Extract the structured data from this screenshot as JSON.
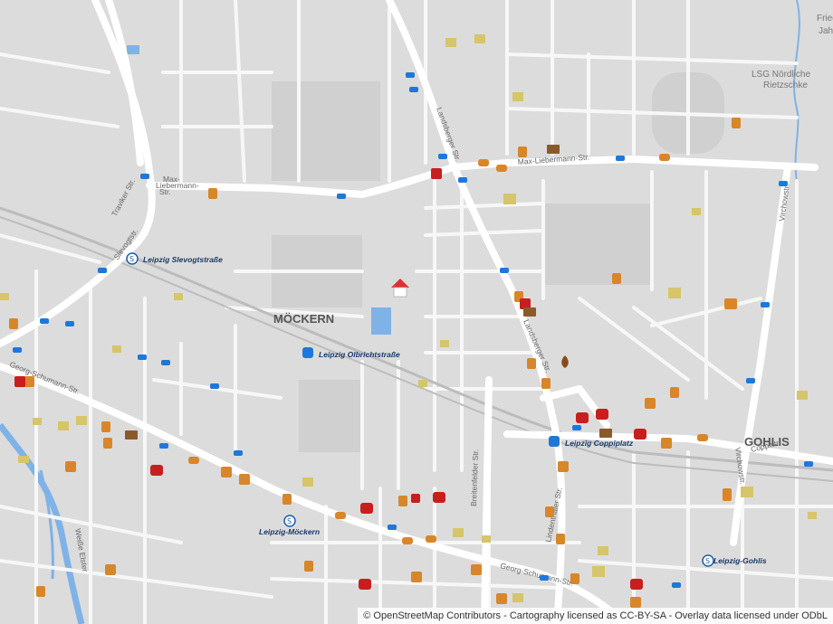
{
  "map": {
    "districts": {
      "moeckern": "MÖCKERN",
      "gohlis": "GOHLIS"
    },
    "areas": {
      "lsg_line1": "LSG Nördliche",
      "lsg_line2": "Rietzschke",
      "corner_line1": "Fried",
      "corner_line2": "Jahn"
    },
    "streets": {
      "traviker": "Traviker Str.",
      "slevogt": "Slevogtstr.",
      "max_liebermann_short1": "Max-",
      "max_liebermann_short2": "Liebermann-",
      "max_liebermann_short3": "Str.",
      "max_liebermann": "Max-Liebermann-Str.",
      "landsberger_top": "Landsberger Str.",
      "landsberger": "Landsberger Str.",
      "virchow_top": "Virchowstr.",
      "virchow_bottom": "Virchowstr.",
      "georg_schumann": "Georg-Schumann-Str.",
      "georg_schumann_b": "Georg-Schumann-Str.",
      "breitenfelder": "Breitenfelder Str.",
      "lindenthaler": "Lindenthaler Str.",
      "coppistr": "Coppistr.",
      "weisse_elster": "Weiße Elster"
    },
    "stops": {
      "slevogtstrasse": "Leipzig Slevogtstraße",
      "olbrichtstrasse": "Leipzig Olbrichtstraße",
      "coppiplatz": "Leipzig Coppiplatz",
      "moeckern_station": "Leipzig-Möckern",
      "gohlis_station": "Leipzig-Gohlis"
    },
    "attribution": "© OpenStreetMap Contributors - Cartography licensed as CC-BY-SA - Overlay data licensed under ODbL",
    "colors": {
      "background": "#dcdcdc",
      "road": "#ffffff",
      "water": "#7fb2e6",
      "poi": "#d8862a",
      "health": "#c81e1e",
      "tram": "#1f78d8",
      "monument": "#d6c56a"
    },
    "icons": [
      "home-marker-icon",
      "tram-stop-icon",
      "train-station-icon",
      "restaurant-icon",
      "fast-food-icon",
      "pharmacy-icon",
      "post-office-icon",
      "monument-icon",
      "fire-station-icon"
    ]
  }
}
